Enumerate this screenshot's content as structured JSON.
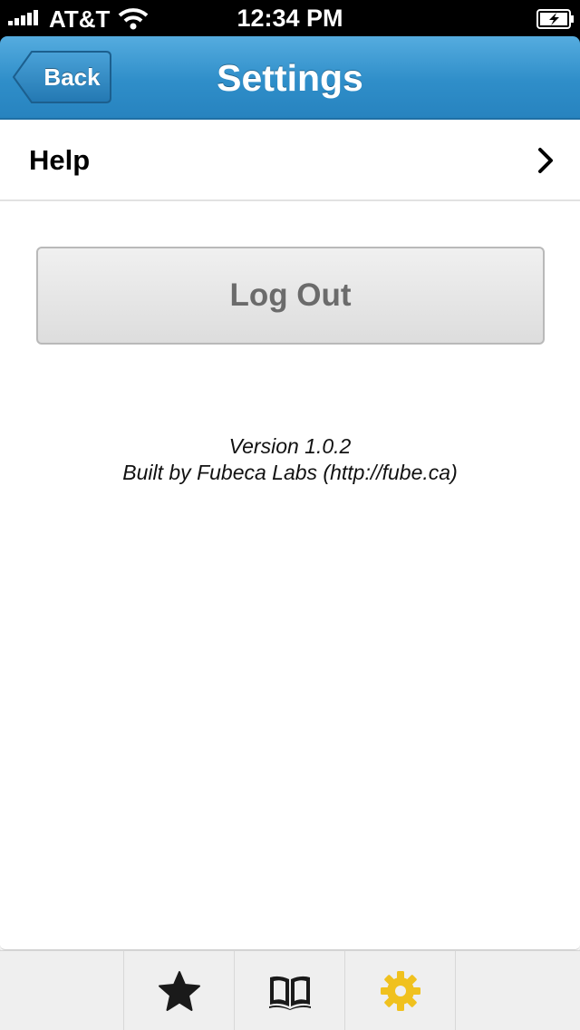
{
  "status_bar": {
    "carrier": "AT&T",
    "time": "12:34 PM",
    "icons": [
      "signal-bars-icon",
      "wifi-icon",
      "battery-charging-icon"
    ]
  },
  "nav": {
    "back_label": "Back",
    "title": "Settings"
  },
  "settings": {
    "help_label": "Help",
    "logout_label": "Log Out"
  },
  "footer_info": {
    "version": "Version 1.0.2",
    "built_by": "Built by Fubeca Labs (http://fube.ca)"
  },
  "tab_bar": {
    "tabs": [
      {
        "icon": "star-icon",
        "active": false
      },
      {
        "icon": "book-icon",
        "active": false
      },
      {
        "icon": "gear-icon",
        "active": true
      }
    ]
  },
  "colors": {
    "nav_blue": "#2f8ec9",
    "active_tab": "#f0c11e",
    "inactive_tab": "#1a1a1a"
  }
}
